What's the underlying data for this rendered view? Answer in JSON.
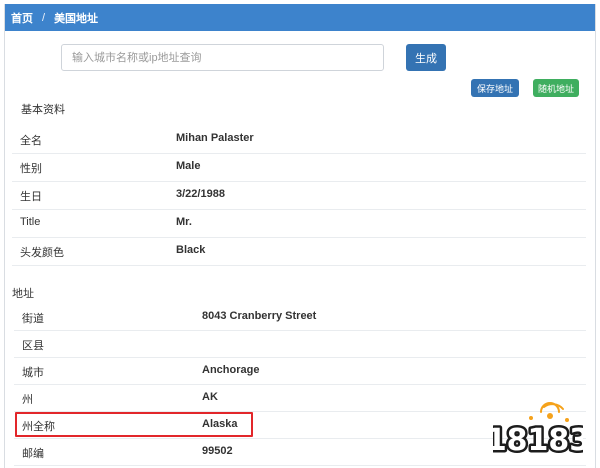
{
  "breadcrumb": {
    "home": "首页",
    "separator": "/",
    "current": "美国地址"
  },
  "search": {
    "placeholder": "输入城市名称或ip地址查询",
    "value": ""
  },
  "buttons": {
    "generate": "生成",
    "save": "保存地址",
    "random": "随机地址"
  },
  "basic_info": {
    "title": "基本资料",
    "rows": [
      {
        "label": "全名",
        "value": "Mihan Palaster"
      },
      {
        "label": "性别",
        "value": "Male"
      },
      {
        "label": "生日",
        "value": "3/22/1988"
      },
      {
        "label": "Title",
        "value": "Mr."
      },
      {
        "label": "头发颜色",
        "value": "Black"
      }
    ]
  },
  "address": {
    "title": "地址",
    "rows": [
      {
        "label": "街道",
        "value": "8043 Cranberry Street"
      },
      {
        "label": "区县",
        "value": ""
      },
      {
        "label": "城市",
        "value": "Anchorage"
      },
      {
        "label": "州",
        "value": "AK"
      },
      {
        "label": "州全称",
        "value": "Alaska"
      },
      {
        "label": "邮编",
        "value": "99502"
      }
    ]
  },
  "highlight_color": "#e2262a",
  "accent_color": "#3d83cc",
  "watermark": {
    "text": "18183"
  }
}
